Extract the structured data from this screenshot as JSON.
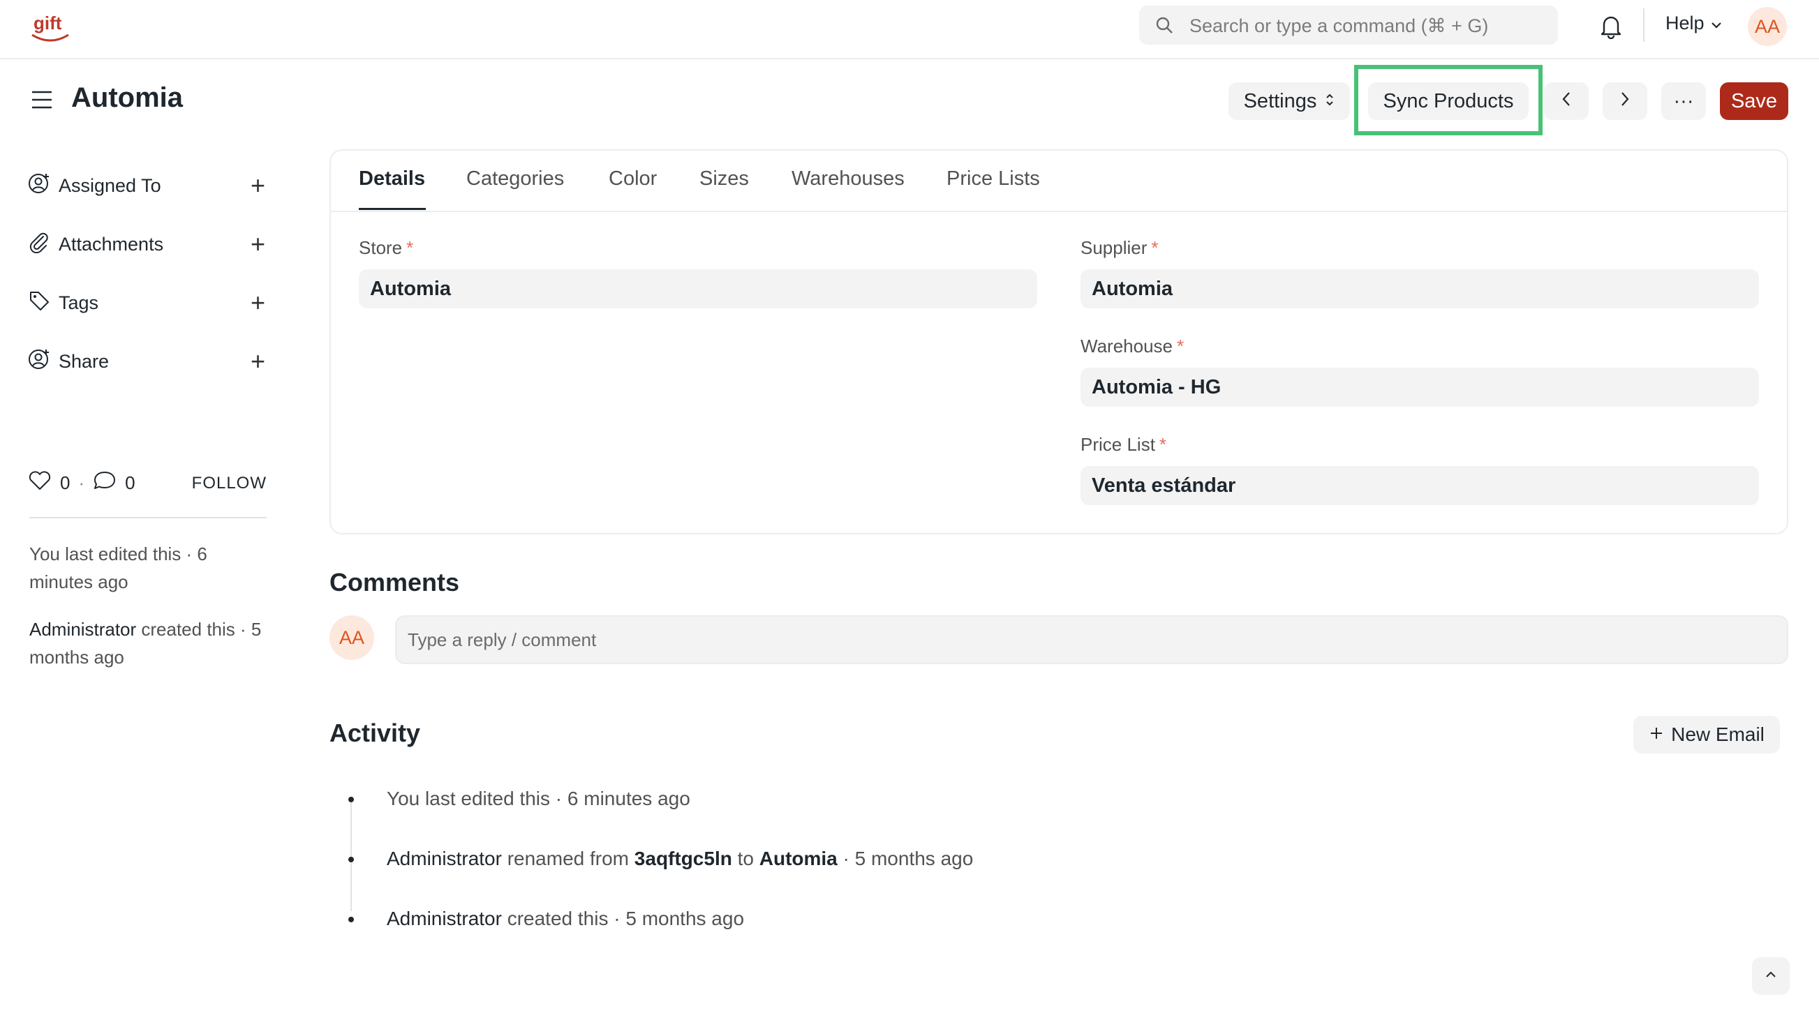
{
  "navbar": {
    "logo_text": "gift",
    "search_placeholder": "Search or type a command (⌘ + G)",
    "help_label": "Help",
    "user_initials": "AA"
  },
  "page": {
    "title": "Automia",
    "settings_label": "Settings",
    "sync_label": "Sync Products",
    "more_label": "···",
    "save_label": "Save"
  },
  "sidebar": {
    "items": [
      {
        "label": "Assigned To",
        "icon": "assign-icon"
      },
      {
        "label": "Attachments",
        "icon": "paperclip-icon"
      },
      {
        "label": "Tags",
        "icon": "tag-icon"
      },
      {
        "label": "Share",
        "icon": "share-icon"
      }
    ],
    "likes": "0",
    "dot_sep": "·",
    "comments_count": "0",
    "follow_label": "FOLLOW",
    "last_edited": "You last edited this · 6 minutes ago",
    "created_by": "Administrator",
    "created_text": " created this · 5 months ago"
  },
  "tabs": [
    "Details",
    "Categories",
    "Color",
    "Sizes",
    "Warehouses",
    "Price Lists"
  ],
  "form": {
    "store": {
      "label": "Store",
      "value": "Automia"
    },
    "supplier": {
      "label": "Supplier",
      "value": "Automia"
    },
    "warehouse": {
      "label": "Warehouse",
      "value": "Automia - HG"
    },
    "price_list": {
      "label": "Price List",
      "value": "Venta estándar"
    },
    "required_mark": "*"
  },
  "comments": {
    "title": "Comments",
    "avatar_initials": "AA",
    "placeholder": "Type a reply / comment"
  },
  "activity": {
    "title": "Activity",
    "new_email_label": "New Email",
    "entries": [
      {
        "text": "You last edited this · 6 minutes ago"
      },
      {
        "actor": "Administrator",
        "pre": " renamed from ",
        "old": "3aqftgc5ln",
        "mid": " to ",
        "new": "Automia",
        "post": " · 5 months ago"
      },
      {
        "actor": "Administrator",
        "post": " created this · 5 months ago"
      }
    ]
  },
  "colors": {
    "accent_save": "#ad2a1a",
    "highlight": "#48c177",
    "avatar_bg": "#fde8de",
    "avatar_fg": "#e0531f"
  }
}
